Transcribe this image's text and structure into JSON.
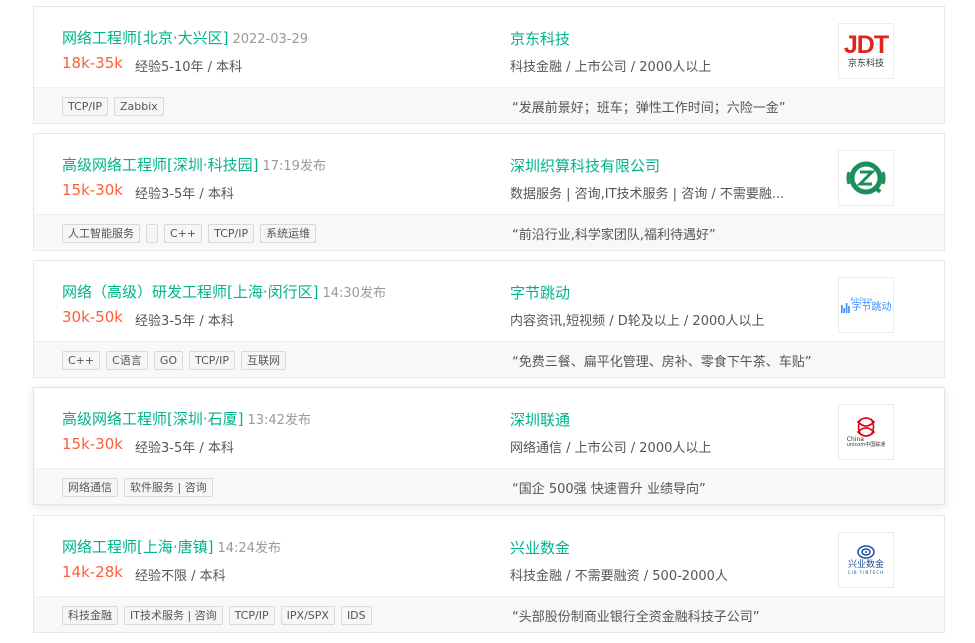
{
  "jobs": [
    {
      "title": "网络工程师[北京·大兴区]",
      "time": "2022-03-29",
      "salary": "18k-35k",
      "requirements": "经验5-10年 / 本科",
      "company": "京东科技",
      "industry": "科技金融 / 上市公司 / 2000人以上",
      "tags": [
        "TCP/IP",
        "Zabbix"
      ],
      "slogan": "“发展前景好；班车；弹性工作时间；六险一金”",
      "logo": "jdt-logo"
    },
    {
      "title": "高级网络工程师[深圳·科技园]",
      "time": "17:19发布",
      "salary": "15k-30k",
      "requirements": "经验3-5年 / 本科",
      "company": "深圳织算科技有限公司",
      "industry": "数据服务 | 咨询,IT技术服务 | 咨询 / 不需要融...",
      "tags": [
        "人工智能服务",
        "",
        "C++",
        "TCP/IP",
        "系统运维"
      ],
      "slogan": "“前沿行业,科学家团队,福利待遇好”",
      "logo": "zhisuan-logo"
    },
    {
      "title": "网络（高级）研发工程师[上海·闵行区]",
      "time": "14:30发布",
      "salary": "30k-50k",
      "requirements": "经验3-5年 / 本科",
      "company": "字节跳动",
      "industry": "内容资讯,短视频 / D轮及以上 / 2000人以上",
      "tags": [
        "C++",
        "C语言",
        "GO",
        "TCP/IP",
        "互联网"
      ],
      "slogan": "“免费三餐、扁平化管理、房补、零食下午茶、车贴”",
      "logo": "bytedance-logo"
    },
    {
      "title": "高级网络工程师[深圳·石厦]",
      "time": "13:42发布",
      "salary": "15k-30k",
      "requirements": "经验3-5年 / 本科",
      "company": "深圳联通",
      "industry": "网络通信 / 上市公司 / 2000人以上",
      "tags": [
        "网络通信",
        "软件服务 | 咨询"
      ],
      "slogan": "“国企 500强 快速晋升 业绩导向”",
      "logo": "china-unicom-logo"
    },
    {
      "title": "网络工程师[上海·唐镇]",
      "time": "14:24发布",
      "salary": "14k-28k",
      "requirements": "经验不限 / 本科",
      "company": "兴业数金",
      "industry": "科技金融 / 不需要融资 / 500-2000人",
      "tags": [
        "科技金融",
        "IT技术服务 | 咨询",
        "TCP/IP",
        "IPX/SPX",
        "IDS"
      ],
      "slogan": "“头部股份制商业银行全资金融科技子公司”",
      "logo": "cib-fintech-logo"
    }
  ],
  "logos": {
    "jdt": {
      "mark": "JDT",
      "sub": "京东科技",
      "color": "#e1251b"
    },
    "bytedance": {
      "sub": "字节跳动",
      "caption": "ByteDance",
      "color": "#3c8cff"
    },
    "unicom": {
      "line1": "China",
      "line2": "unicom中国联通",
      "color": "#e60012"
    },
    "cib": {
      "name": "兴业数金",
      "caption": "CIB FINTECH",
      "color": "#1b4e9b"
    }
  }
}
